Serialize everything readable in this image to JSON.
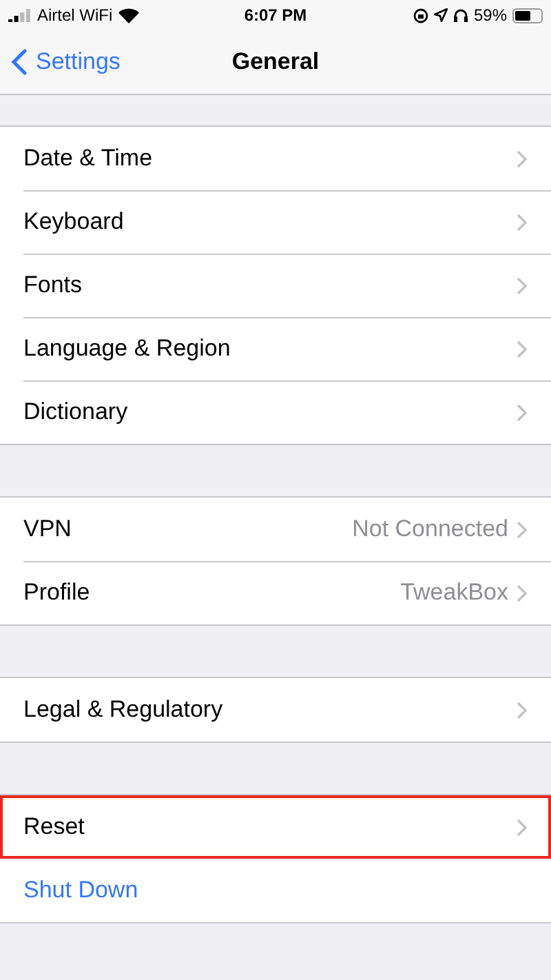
{
  "status_bar": {
    "carrier": "Airtel WiFi",
    "time": "6:07 PM",
    "battery": "59%"
  },
  "nav": {
    "back": "Settings",
    "title": "General"
  },
  "groups": [
    {
      "rows": [
        {
          "label": "Date & Time",
          "kind": "link",
          "highlighted": false
        },
        {
          "label": "Keyboard",
          "kind": "link",
          "highlighted": false
        },
        {
          "label": "Fonts",
          "kind": "link",
          "highlighted": false
        },
        {
          "label": "Language & Region",
          "kind": "link",
          "highlighted": false
        },
        {
          "label": "Dictionary",
          "kind": "link",
          "highlighted": false
        }
      ]
    },
    {
      "rows": [
        {
          "label": "VPN",
          "value": "Not Connected",
          "kind": "link",
          "highlighted": false
        },
        {
          "label": "Profile",
          "value": "TweakBox",
          "kind": "link",
          "highlighted": false
        }
      ]
    },
    {
      "rows": [
        {
          "label": "Legal & Regulatory",
          "kind": "link",
          "highlighted": false
        }
      ]
    },
    {
      "rows": [
        {
          "label": "Reset",
          "kind": "link",
          "highlighted": true
        },
        {
          "label": "Shut Down",
          "kind": "action",
          "highlighted": false
        }
      ]
    }
  ]
}
